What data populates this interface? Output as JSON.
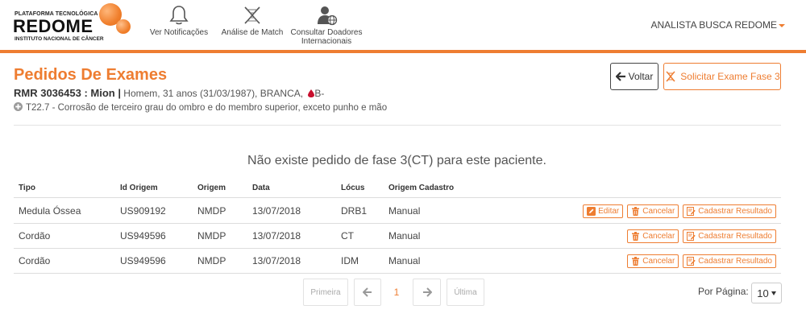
{
  "header": {
    "logo": {
      "line1": "PLATAFORMA TECNOLÓGICA",
      "line2": "REDOME",
      "line3": "INSTITUTO NACIONAL DE CÂNCER"
    },
    "nav": [
      {
        "label": "Ver Notificações",
        "icon": "bell-icon"
      },
      {
        "label": "Análise de Match",
        "icon": "dna-icon"
      },
      {
        "label": "Consultar Doadores Internacionais",
        "icon": "user-globe-icon"
      }
    ],
    "user": "ANALISTA BUSCA REDOME",
    "accent": "#ee7d31"
  },
  "page": {
    "title": "Pedidos De Exames",
    "rmr": "RMR 3036453 : Mion |",
    "patient_info": "Homem, 31 anos (31/03/1987), BRANCA,",
    "blood_type": "B-",
    "diagnosis": "T22.7 - Corrosão de terceiro grau do ombro e do membro superior, exceto punho e mão",
    "btn_voltar": "Voltar",
    "btn_solicitar": "Solicitar Exame Fase 3",
    "empty_message": "Não existe pedido de fase 3(CT) para este paciente."
  },
  "table": {
    "headers": [
      "Tipo",
      "Id Origem",
      "Origem",
      "Data",
      "Lócus",
      "Origem Cadastro"
    ],
    "rows": [
      {
        "tipo": "Medula Óssea",
        "id": "US909192",
        "origem": "NMDP",
        "data": "13/07/2018",
        "locus": "DRB1",
        "origem_cadastro": "Manual",
        "actions": [
          "Editar",
          "Cancelar",
          "Cadastrar Resultado"
        ]
      },
      {
        "tipo": "Cordão",
        "id": "US949596",
        "origem": "NMDP",
        "data": "13/07/2018",
        "locus": "CT",
        "origem_cadastro": "Manual",
        "actions": [
          "Cancelar",
          "Cadastrar Resultado"
        ]
      },
      {
        "tipo": "Cordão",
        "id": "US949596",
        "origem": "NMDP",
        "data": "13/07/2018",
        "locus": "IDM",
        "origem_cadastro": "Manual",
        "actions": [
          "Cancelar",
          "Cadastrar Resultado"
        ]
      }
    ]
  },
  "pagination": {
    "first": "Primeira",
    "current": "1",
    "last": "Última",
    "per_page_label": "Por Página:",
    "per_page_value": "10"
  }
}
